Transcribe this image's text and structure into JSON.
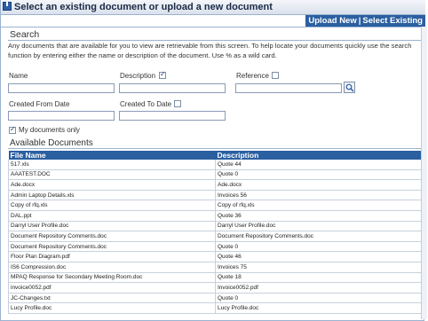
{
  "window": {
    "title": "Select an existing document or upload a new document"
  },
  "tabs": {
    "upload_new": "Upload New",
    "separator": "|",
    "select_existing": "Select Existing"
  },
  "search": {
    "heading": "Search",
    "description": "Any documents that are available for you to view are retrievable from this screen. To help locate your documents quickly use the search function by entering either the name or description of the document. Use % as a wild card.",
    "name_label": "Name",
    "description_label": "Description",
    "description_checked": true,
    "reference_label": "Reference",
    "reference_checked": false,
    "created_from_label": "Created From Date",
    "created_to_label": "Created To Date",
    "created_to_checked": false,
    "my_docs_label": "My documents only",
    "my_docs_checked": true,
    "name_value": "",
    "description_value": "",
    "reference_value": "",
    "created_from_value": "",
    "created_to_value": ""
  },
  "documents": {
    "heading": "Available Documents",
    "columns": [
      "File Name",
      "Description"
    ],
    "rows": [
      [
        "517.xls",
        "Quote 44"
      ],
      [
        "AAATEST.DOC",
        "Quote 0"
      ],
      [
        "Ade.docx",
        "Ade.docx"
      ],
      [
        "Admin Laptop Details.xls",
        "Invoices 56"
      ],
      [
        "Copy of rfq.xls",
        "Copy of rfq.xls"
      ],
      [
        "DAL.ppt",
        "Quote 36"
      ],
      [
        "Darryl User Profile.doc",
        "Darryl User Profile.doc"
      ],
      [
        "Document Repository Comments.doc",
        "Document Repository Comments.doc"
      ],
      [
        "Document Repository Comments.doc",
        "Quote 0"
      ],
      [
        "Floor Plan Diagram.pdf",
        "Quote 46"
      ],
      [
        "IS6 Compression.doc",
        "Invoices 75"
      ],
      [
        "MPAQ Response for Secondary Meeting Room.doc",
        "Quote 18"
      ],
      [
        "invoice0052.pdf",
        "Invoice0052.pdf"
      ],
      [
        "JC-Changes.txt",
        "Quote 0"
      ],
      [
        "Lucy Profile.doc",
        "Lucy Profile.doc"
      ]
    ]
  }
}
